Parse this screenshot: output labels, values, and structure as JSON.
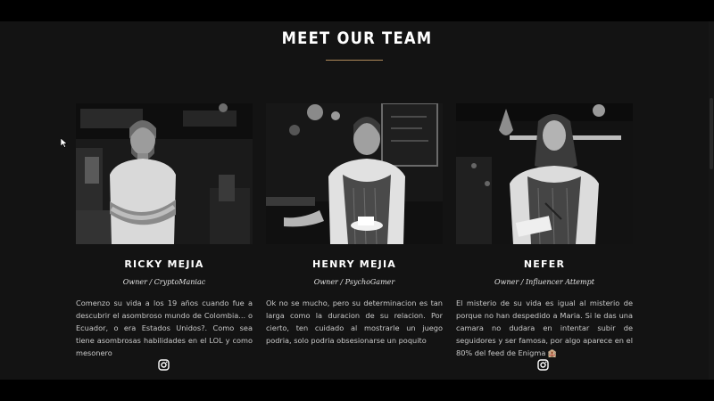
{
  "section": {
    "title": "MEET OUR TEAM",
    "accent": "#b08a5a"
  },
  "team": [
    {
      "name": "RICKY MEJIA",
      "role": "Owner / CryptoManiac",
      "bio": "Comenzo su vida a los 19 años cuando fue a descubrir el asombroso mundo de Colombia... o Ecuador, o era Estados Unidos?. Como sea tiene asombrosas habilidades en el LOL y como mesonero",
      "social_icon": "instagram-icon"
    },
    {
      "name": "HENRY MEJIA",
      "role": "Owner / PsychoGamer",
      "bio": "Ok no se mucho, pero su determinacion es tan larga como la duracion de su relacion. Por cierto, ten cuidado al mostrarle un juego podria, solo podria obsesionarse un poquito",
      "social_icon": "instagram-icon"
    },
    {
      "name": "NEFER",
      "role": "Owner / Influencer Attempt",
      "bio": "El misterio de su vida es igual al misterio de porque no han despedido a Maria. Si le das una camara no dudara en intentar subir de seguidores y ser famosa, por algo aparece en el 80% del feed de Enigma 🏨",
      "social_icon": "instagram-icon"
    }
  ]
}
